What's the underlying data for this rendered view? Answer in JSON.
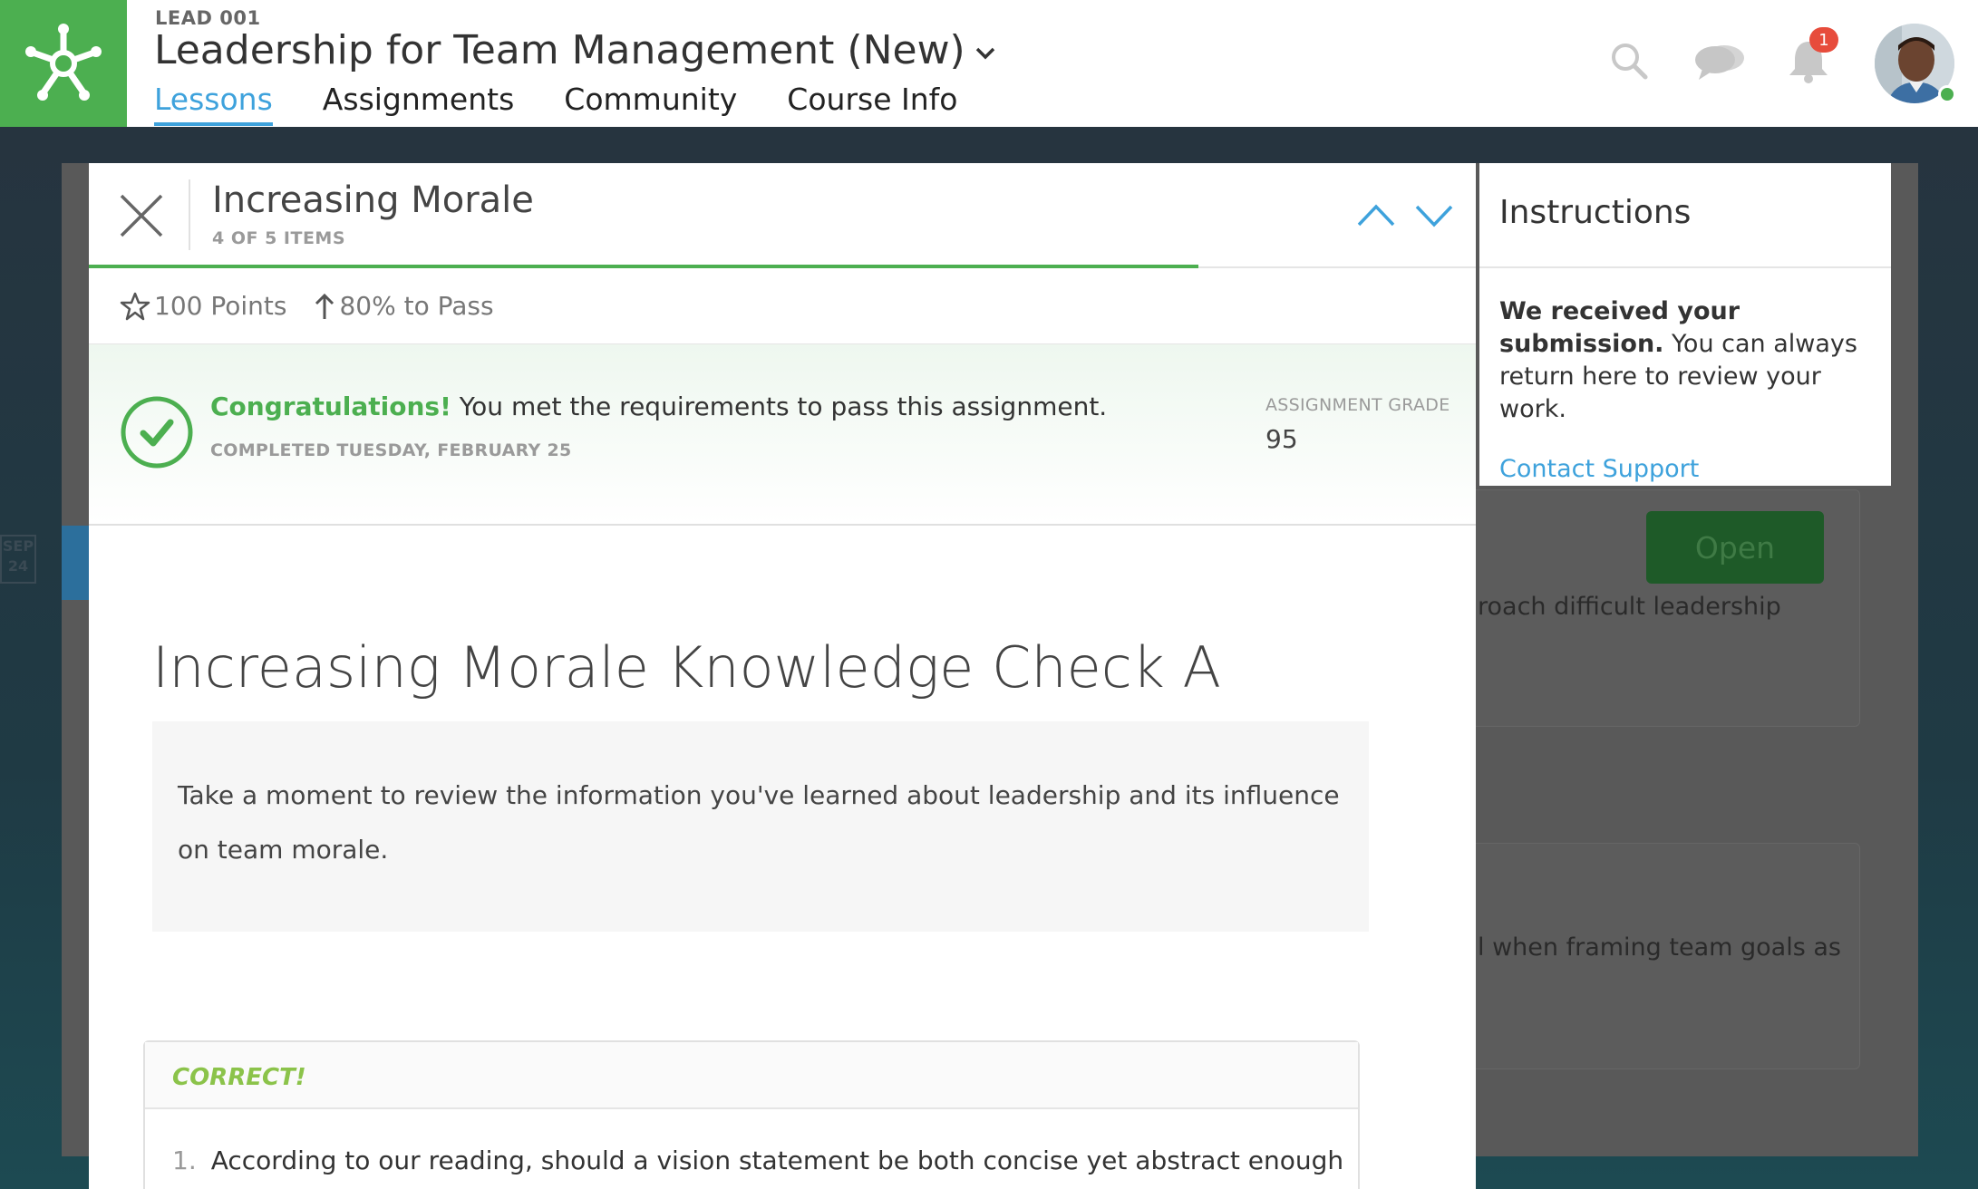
{
  "header": {
    "course_code": "LEAD 001",
    "course_title": "Leadership for Team Management (New)",
    "tabs": [
      {
        "label": "Lessons",
        "active": true
      },
      {
        "label": "Assignments",
        "active": false
      },
      {
        "label": "Community",
        "active": false
      },
      {
        "label": "Course Info",
        "active": false
      }
    ],
    "notifications_count": "1",
    "icons": [
      "search-icon",
      "chat-icon",
      "bell-icon"
    ]
  },
  "modal": {
    "item_title": "Increasing Morale",
    "item_position": "4 OF 5 ITEMS",
    "progress": 0.8,
    "points": "100 Points",
    "pass_threshold": "80% to Pass",
    "banner": {
      "highlight": "Congratulations!",
      "message": " You met the requirements to pass this assignment.",
      "completed": "COMPLETED TUESDAY, FEBRUARY 25",
      "grade_label": "ASSIGNMENT GRADE",
      "grade_value": "95"
    },
    "content_title": "Increasing Morale Knowledge Check A",
    "intro_text": "Take a moment to review the information you've learned about leadership and its influence on team morale.",
    "question_status": "CORRECT!",
    "question_number": "1.",
    "question_text": "According to our reading, should a vision statement be both concise yet abstract enough"
  },
  "instructions": {
    "title": "Instructions",
    "strong": "We received your submission.",
    "text": " You can always return here to review your work.",
    "link": "Contact Support"
  },
  "background": {
    "open_button": "Open",
    "snippet_1": "roach difficult leadership",
    "snippet_2": "l when framing team goals as",
    "date_month": "SEP",
    "date_day": "24"
  },
  "colors": {
    "brand_green": "#4caf50",
    "link_blue": "#3ea2dc",
    "correct_green": "#8bc34a",
    "badge_red": "#e74c3c"
  }
}
